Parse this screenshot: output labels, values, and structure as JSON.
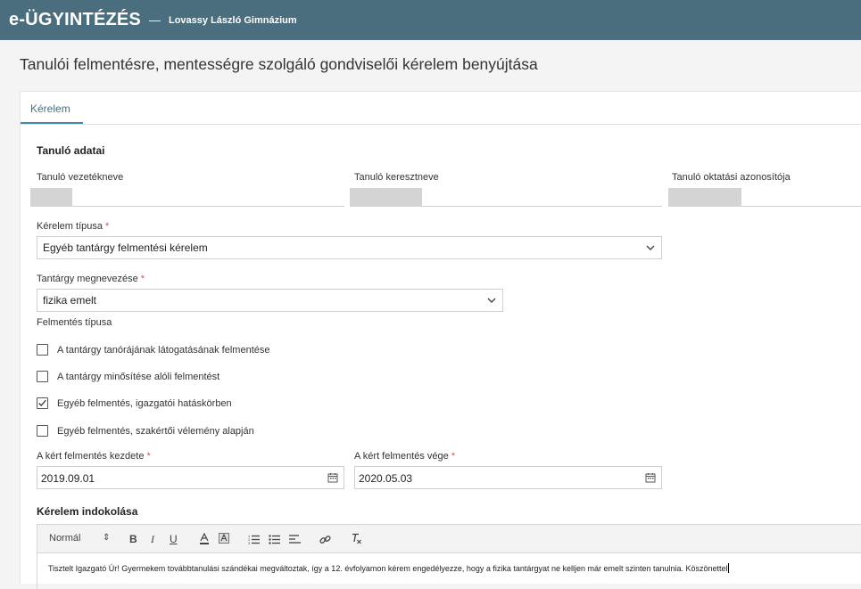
{
  "header": {
    "brand": "e-ÜGYINTÉZÉS",
    "separator": "—",
    "school": "Lovassy László Gimnázium"
  },
  "page": {
    "title": "Tanulói felmentésre, mentességre szolgáló gondviselői kérelem benyújtása"
  },
  "tabs": [
    {
      "label": "Kérelem",
      "active": true
    }
  ],
  "student": {
    "section_title": "Tanuló adatai",
    "last_name_label": "Tanuló vezetékneve",
    "first_name_label": "Tanuló keresztneve",
    "education_id_label": "Tanuló oktatási azonosítója"
  },
  "request_type": {
    "label": "Kérelem típusa",
    "required_mark": "*",
    "value": "Egyéb tantárgy felmentési kérelem"
  },
  "subject": {
    "label": "Tantárgy megnevezése",
    "required_mark": "*",
    "value": "fizika emelt"
  },
  "exemption_type": {
    "label": "Felmentés típusa",
    "options": [
      {
        "label": "A tantárgy tanórájának látogatásának felmentése",
        "checked": false
      },
      {
        "label": "A tantárgy minősítése alóli felmentést",
        "checked": false
      },
      {
        "label": "Egyéb felmentés, igazgatói hatáskörben",
        "checked": true
      },
      {
        "label": "Egyéb felmentés, szakértői vélemény alapján",
        "checked": false
      }
    ]
  },
  "dates": {
    "start_label": "A kért felmentés kezdete",
    "start_value": "2019.09.01",
    "end_label": "A kért felmentés vége",
    "end_value": "2020.05.03",
    "required_mark": "*"
  },
  "justification": {
    "section_title": "Kérelem indokolása",
    "format_select": "Normál",
    "text": "Tisztelt Igazgató Úr! Gyermekem továbbtanulási szándékai megváltoztak, így a 12. évfolyamon kérem engedélyezze, hogy a fizika tantárgyat ne kelljen már emelt szinten tanulnia. Köszönettel"
  },
  "colors": {
    "header_bg": "#4a6e7d",
    "tab_accent": "#4a8aa8",
    "required": "#d9534f"
  }
}
